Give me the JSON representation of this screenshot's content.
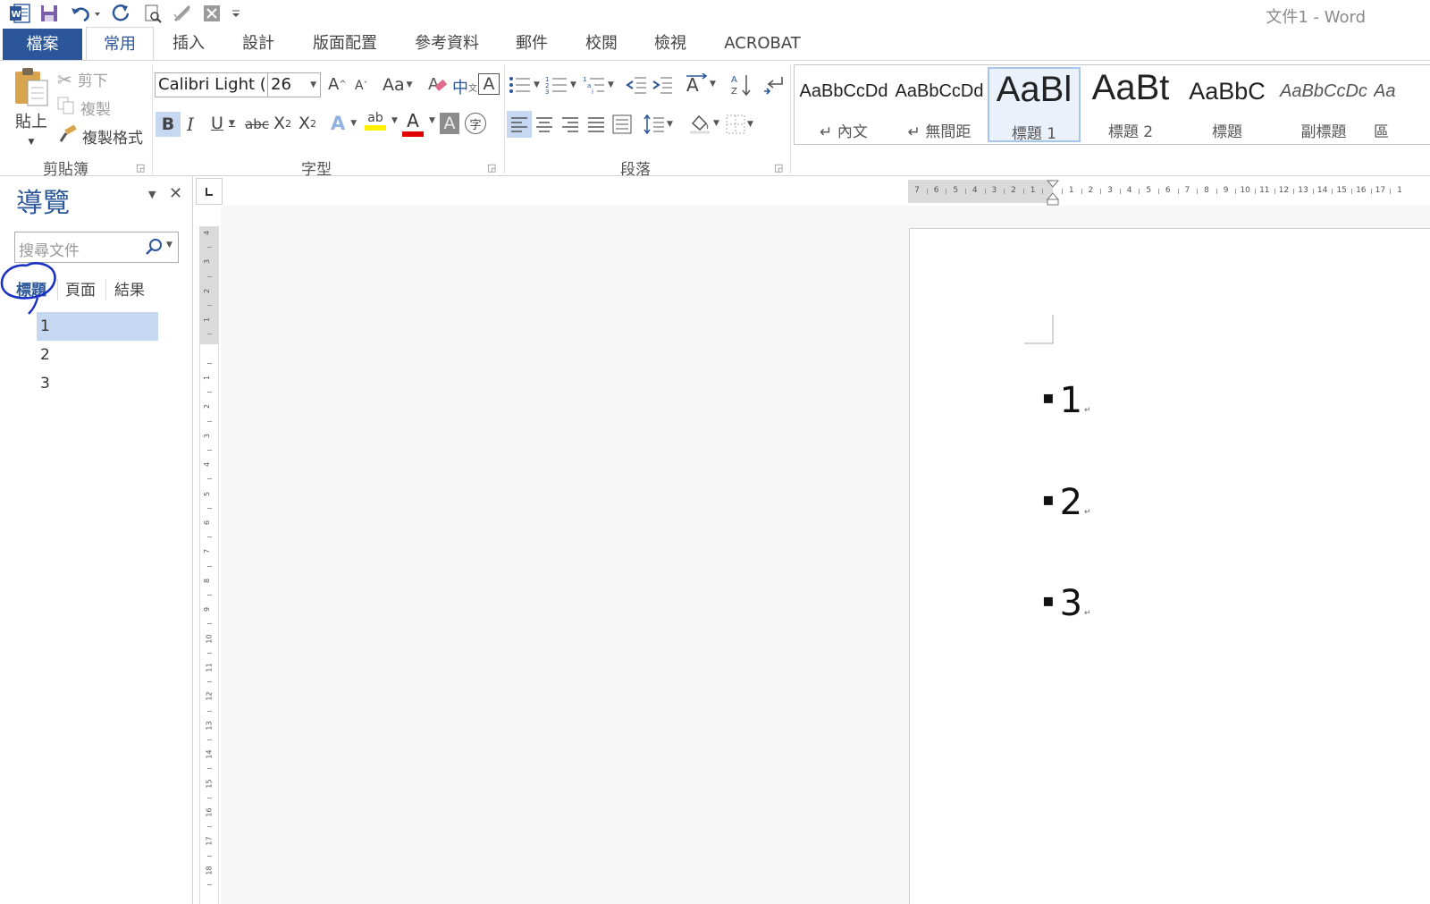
{
  "title_bar": {
    "doc_title": "文件1 - Word",
    "quick_access": [
      "word-logo-icon",
      "save-icon",
      "undo-icon",
      "redo-icon",
      "print-preview-icon",
      "spelling-icon",
      "close-file-icon",
      "customize-qat-icon"
    ]
  },
  "tabs": [
    "檔案",
    "常用",
    "插入",
    "設計",
    "版面配置",
    "參考資料",
    "郵件",
    "校閱",
    "檢視",
    "ACROBAT"
  ],
  "ribbon": {
    "clipboard": {
      "group_label": "剪貼簿",
      "paste": "貼上",
      "cut": "剪下",
      "copy": "複製",
      "format_painter": "複製格式"
    },
    "font": {
      "group_label": "字型",
      "font_name": "Calibri Light (",
      "font_size": "26",
      "change_case": "Aa",
      "bold": "B",
      "italic": "I",
      "underline": "U",
      "strike": "abc",
      "subscript": "X",
      "superscript": "X",
      "phonetic": "中",
      "char_border": "A",
      "text_effect": "A",
      "highlight": "ab",
      "font_color": "A",
      "char_shading": "A",
      "enclose": "字"
    },
    "paragraph": {
      "group_label": "段落"
    },
    "styles": [
      {
        "sample": "AaBbCcDd",
        "name": "↵ 內文"
      },
      {
        "sample": "AaBbCcDd",
        "name": "↵ 無間距"
      },
      {
        "sample": "AaBl",
        "name": "標題 1"
      },
      {
        "sample": "AaBt",
        "name": "標題 2"
      },
      {
        "sample": "AaBbC",
        "name": "標題"
      },
      {
        "sample": "AaBbCcDc",
        "name": "副標題"
      },
      {
        "sample": "Aa",
        "name": "區"
      }
    ]
  },
  "nav_pane": {
    "title": "導覽",
    "search_placeholder": "搜尋文件",
    "tabs": [
      "標題",
      "頁面",
      "結果"
    ],
    "headings": [
      "1",
      "2",
      "3"
    ],
    "selected_heading": 0
  },
  "document": {
    "headings": [
      "1",
      "2",
      "3"
    ],
    "paragraph_mark": "↵"
  },
  "hruler_labels": [
    "7",
    "6",
    "5",
    "4",
    "3",
    "2",
    "1",
    "",
    "1",
    "2",
    "3",
    "4",
    "5",
    "6",
    "7",
    "8",
    "9",
    "10",
    "11",
    "12",
    "13",
    "14",
    "15",
    "16",
    "17",
    "1"
  ],
  "vruler_labels": [
    "4",
    "3",
    "2",
    "1",
    "",
    "1",
    "2",
    "3",
    "4",
    "5",
    "6",
    "7",
    "8",
    "9",
    "10",
    "11",
    "12",
    "13",
    "14",
    "15",
    "16",
    "17",
    "18"
  ],
  "colors": {
    "accent": "#2b579a",
    "selected": "#c5d7f1",
    "annotation": "#1a2fc4"
  }
}
